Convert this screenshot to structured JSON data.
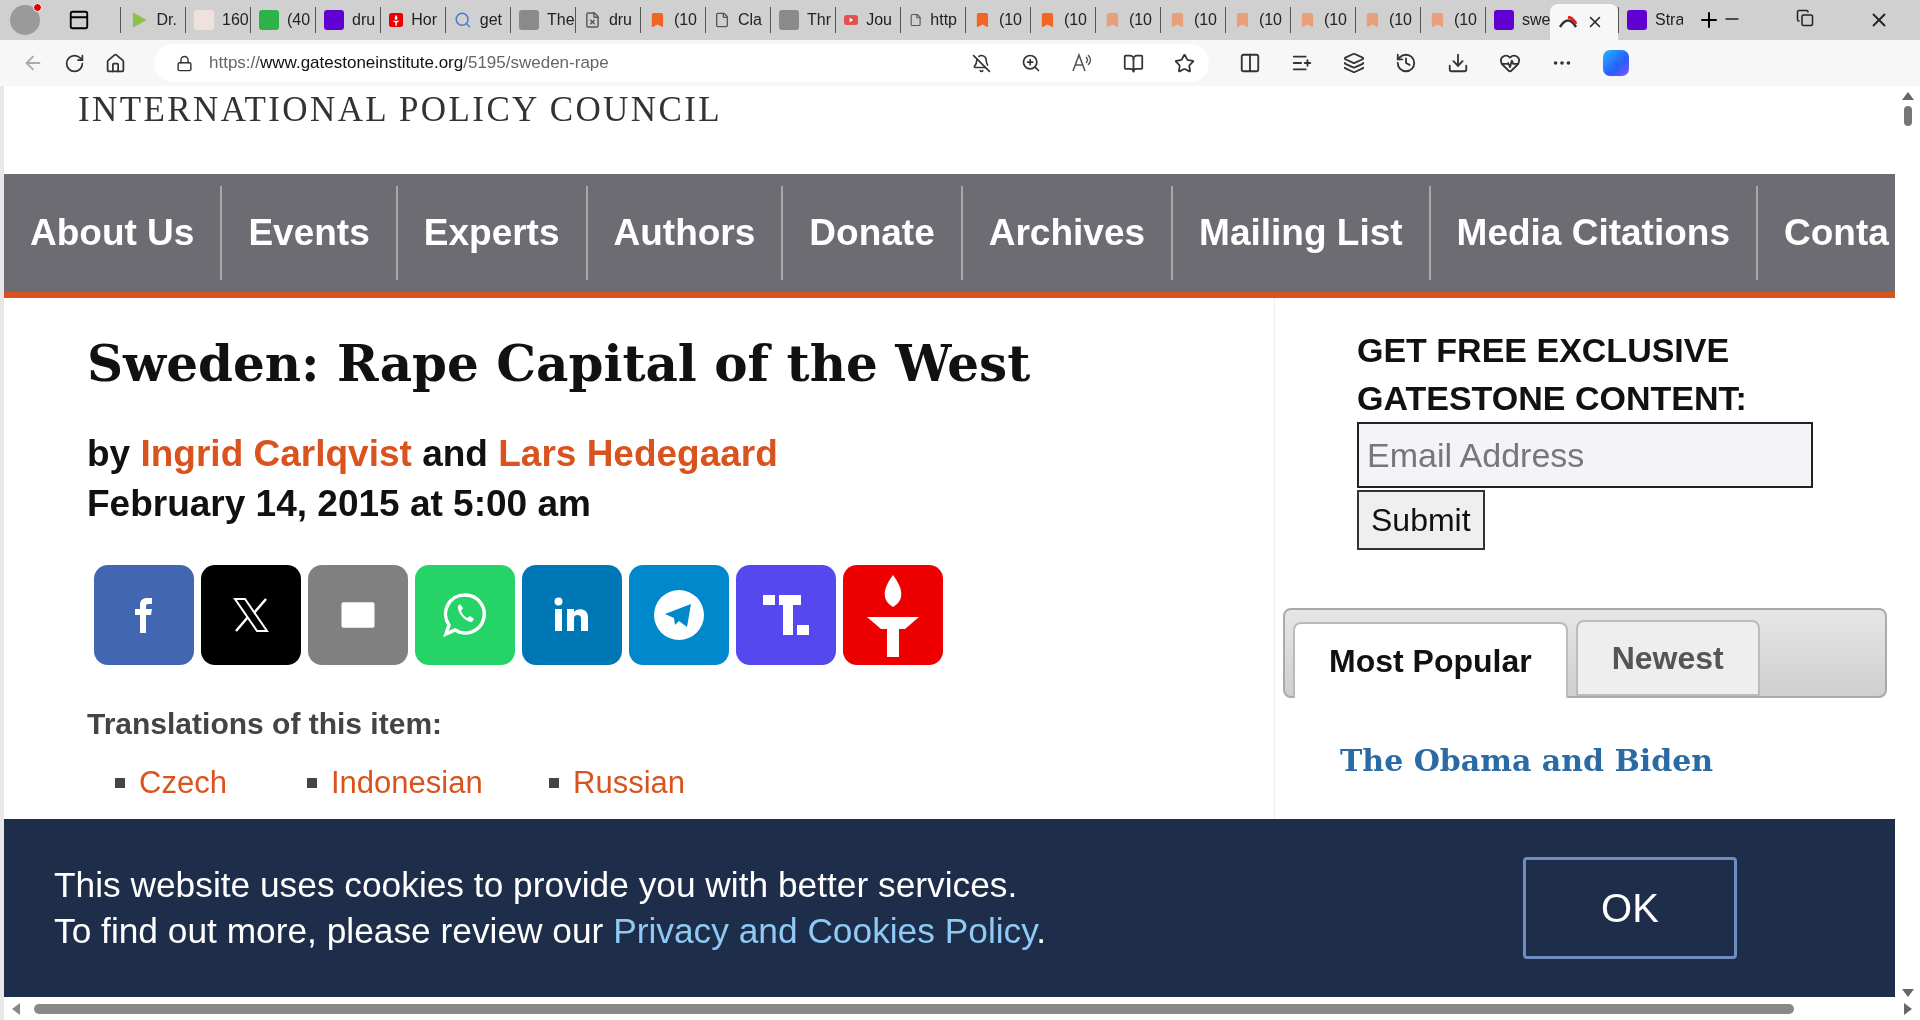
{
  "browser": {
    "tabs": [
      {
        "kind": "play",
        "title": "Dr.",
        "selected": false
      },
      {
        "kind": "tile",
        "title": "160",
        "selected": false
      },
      {
        "kind": "green-tile",
        "title": "(40",
        "selected": false
      },
      {
        "kind": "purple-tile",
        "title": "dru",
        "selected": false
      },
      {
        "kind": "torch",
        "title": "Hor",
        "selected": false
      },
      {
        "kind": "search",
        "title": "get",
        "selected": false
      },
      {
        "kind": "gray-tile",
        "title": "The",
        "selected": false
      },
      {
        "kind": "page-x",
        "title": "dru",
        "selected": false
      },
      {
        "kind": "bookmark",
        "title": "(10",
        "selected": false
      },
      {
        "kind": "page",
        "title": "Cla",
        "selected": false
      },
      {
        "kind": "gray-tile",
        "title": "Thr",
        "selected": false
      },
      {
        "kind": "video",
        "title": "Jou",
        "selected": false
      },
      {
        "kind": "page",
        "title": "http",
        "selected": false
      },
      {
        "kind": "bookmark",
        "title": "(10",
        "selected": false
      },
      {
        "kind": "bookmark",
        "title": "(10",
        "selected": false
      },
      {
        "kind": "pale-bookmark",
        "title": "(10",
        "selected": false
      },
      {
        "kind": "pale-bookmark",
        "title": "(10",
        "selected": false
      },
      {
        "kind": "pale-bookmark",
        "title": "(10",
        "selected": false
      },
      {
        "kind": "pale-bookmark",
        "title": "(10",
        "selected": false
      },
      {
        "kind": "pale-bookmark",
        "title": "(10",
        "selected": false
      },
      {
        "kind": "pale-bookmark",
        "title": "(10",
        "selected": false
      },
      {
        "kind": "purple-tile",
        "title": "swe",
        "selected": false
      },
      {
        "kind": "arc",
        "selected": true
      },
      {
        "kind": "purple-tile",
        "title": "Stra",
        "selected": false
      }
    ],
    "address": {
      "scheme": "https://",
      "host": "www.gatestoneinstitute.org",
      "path": "/5195/sweden-rape"
    }
  },
  "page": {
    "site_title": "INTERNATIONAL POLICY COUNCIL",
    "nav": [
      "About Us",
      "Events",
      "Experts",
      "Authors",
      "Donate",
      "Archives",
      "Mailing List",
      "Media Citations",
      "Conta"
    ],
    "article": {
      "title": "Sweden: Rape Capital of the West",
      "byline": {
        "prefix": "by",
        "joiner": "and",
        "authors": [
          "Ingrid Carlqvist",
          "Lars Hedegaard"
        ]
      },
      "date": "February 14, 2015 at 5:00 am",
      "share": [
        {
          "kind": "facebook"
        },
        {
          "kind": "x"
        },
        {
          "kind": "email"
        },
        {
          "kind": "whatsapp"
        },
        {
          "kind": "linkedin"
        },
        {
          "kind": "telegram"
        },
        {
          "kind": "truth"
        },
        {
          "kind": "torch"
        }
      ],
      "translations_heading": "Translations of this item:",
      "translations": [
        [
          "Czech"
        ],
        [
          "Indonesian"
        ],
        [
          "Russian"
        ]
      ]
    },
    "sidebar": {
      "heading_lines": [
        "GET FREE EXCLUSIVE",
        "GATESTONE CONTENT:"
      ],
      "email": {
        "placeholder": "Email Address"
      },
      "submit": "Submit",
      "tabs": [
        {
          "label": "Most Popular",
          "selected": true
        },
        {
          "label": "Newest",
          "selected": false
        }
      ],
      "story": {
        "title": "The Obama and Biden"
      }
    },
    "cookie_banner": {
      "line1": "This website uses cookies to provide you with better services.",
      "line2": "To find out more, please review our ",
      "link": "Privacy and Cookies Policy",
      "end": ".",
      "button": "OK"
    }
  }
}
